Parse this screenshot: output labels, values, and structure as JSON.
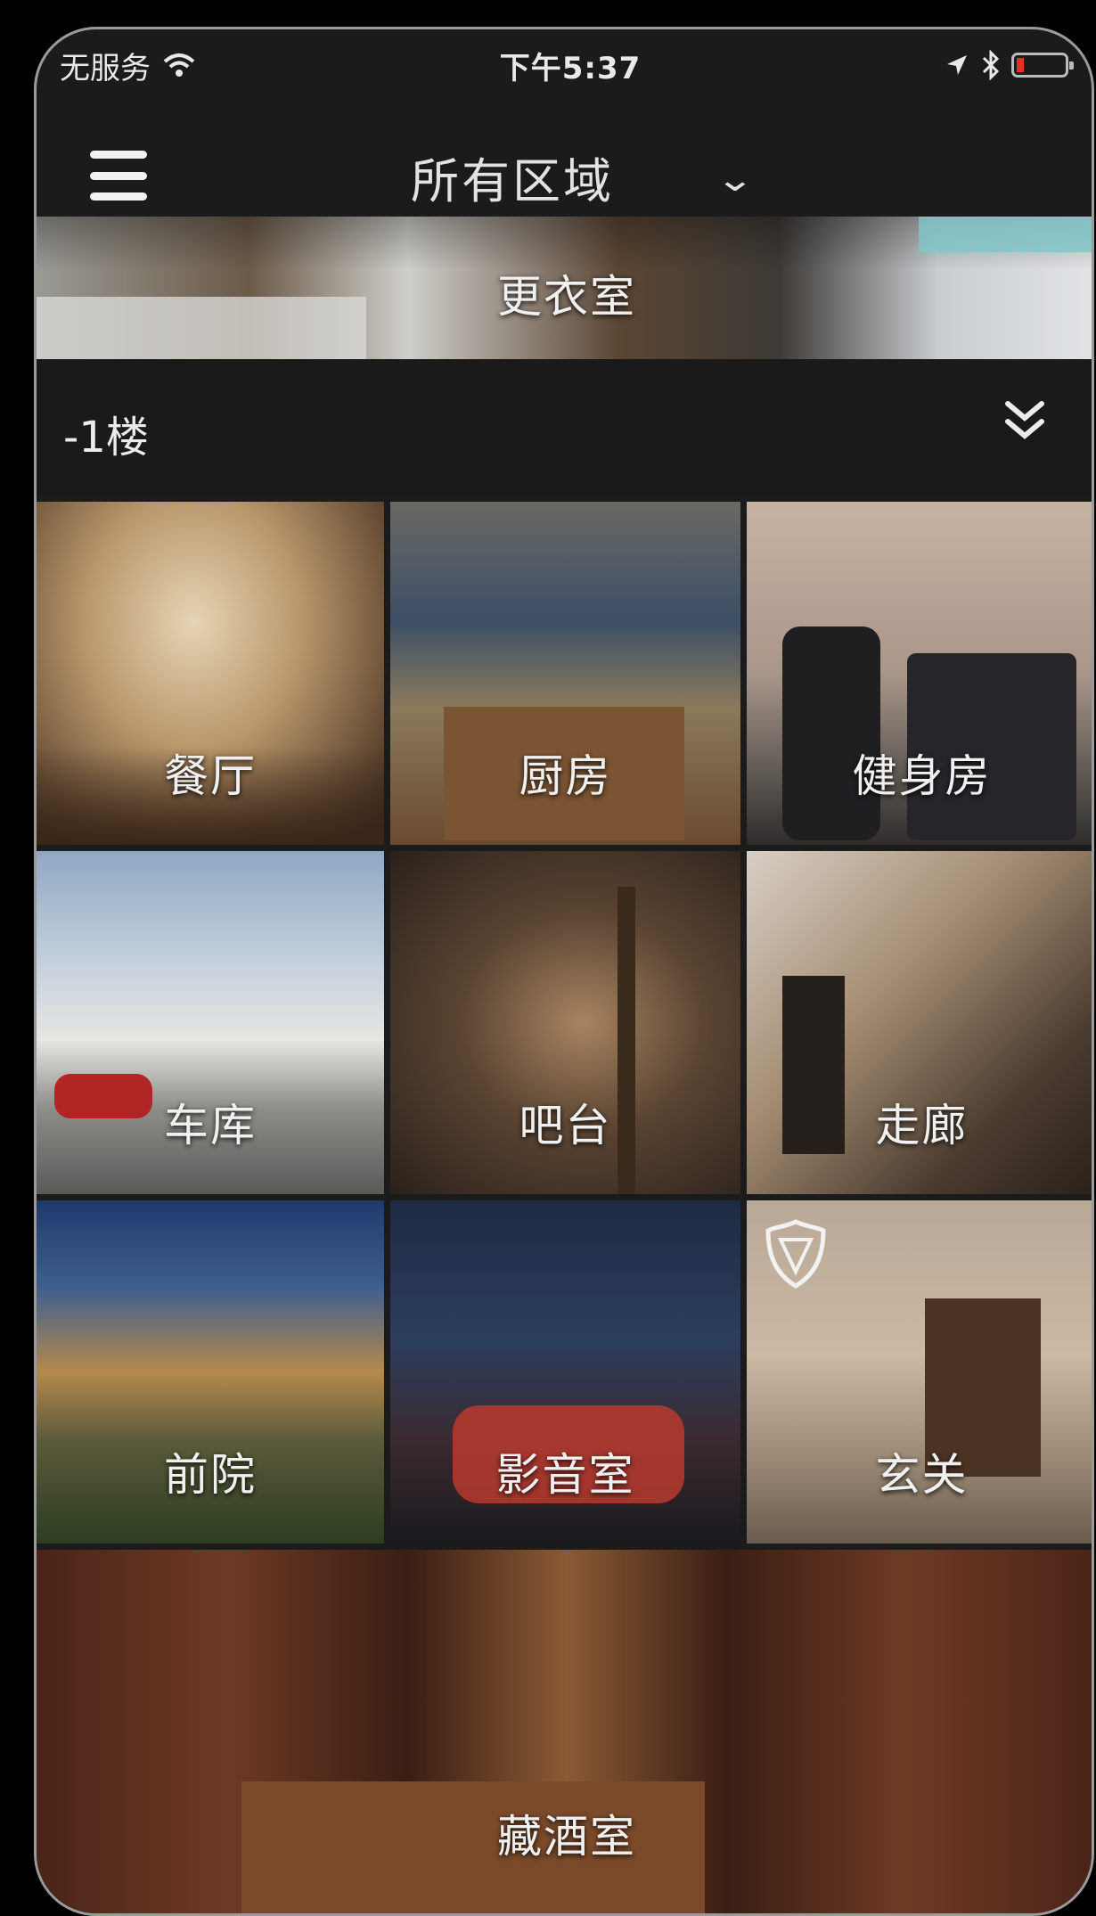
{
  "status_bar": {
    "carrier": "无服务",
    "time": "下午5:37"
  },
  "nav": {
    "title": "所有区域"
  },
  "top_room": {
    "label": "更衣室"
  },
  "floor": {
    "label": "-1楼"
  },
  "rooms": [
    {
      "label": "餐厅"
    },
    {
      "label": "厨房"
    },
    {
      "label": "健身房"
    },
    {
      "label": "车库"
    },
    {
      "label": "吧台"
    },
    {
      "label": "走廊"
    },
    {
      "label": "前院"
    },
    {
      "label": "影音室"
    },
    {
      "label": "玄关"
    }
  ],
  "bottom_room": {
    "label": "藏酒室"
  },
  "colors": {
    "background": "#1b1b1b",
    "text": "#e8e8e8",
    "battery_low": "#e0312b"
  }
}
